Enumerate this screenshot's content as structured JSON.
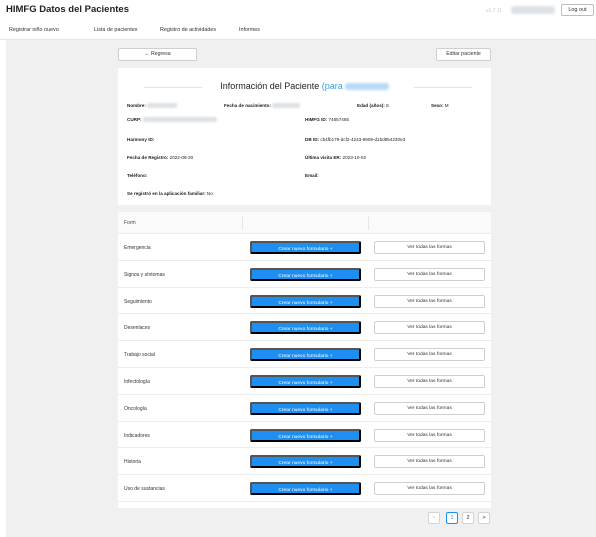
{
  "app": {
    "title": "HIMFG Datos del Pacientes",
    "version": "v1.7.11",
    "logout_label": "Log out"
  },
  "nav": [
    "Registrar niño nuevo",
    "Lista de pacientes",
    "Registro de actividades",
    "Informes"
  ],
  "actions": {
    "back_label": "← Regresa",
    "edit_label": "Editar paciente"
  },
  "patient": {
    "title_prefix": "Información del Paciente",
    "title_para": "(para",
    "name_label": "Nombre:",
    "dob_label": "Fecha de nacimiento:",
    "age_label": "Edad (años):",
    "age_value": "8",
    "sex_label": "Sexo:",
    "sex_value": "M",
    "curp_label": "CURP:",
    "himfg_label": "HIMFG ID:",
    "himfg_value": "74657465",
    "harmony_label": "Harmony ID:",
    "db_label": "DB ID:",
    "db_value": "cb4fb179-dcf2-4243-9909-d1bd854230e3",
    "reg_label": "Fecha de Registro:",
    "reg_value": "2022-08-30",
    "er_label": "Última visita ER:",
    "er_value": "2023-10-02",
    "phone_label": "Teléfono:",
    "email_label": "Email:",
    "app_label": "Se registró en la aplicación familiar:",
    "app_value": "No"
  },
  "table": {
    "header": "Form",
    "create_label": "Crear nuevo formulario +",
    "view_label": "Ver todas las formas",
    "rows": [
      "Emergencia",
      "Signos y síntomas",
      "Seguimiento",
      "Desenlaces",
      "Trabajo social",
      "Infectología",
      "Oncología",
      "Indicadores",
      "Historia",
      "Uso de sustancias"
    ]
  },
  "pagination": {
    "prev": "<",
    "pages": [
      "1",
      "2"
    ],
    "next": ">",
    "current": "1"
  },
  "colors": {
    "accent": "#1f8ef1",
    "link": "#3aa0e8",
    "background": "#f0f0f0"
  }
}
